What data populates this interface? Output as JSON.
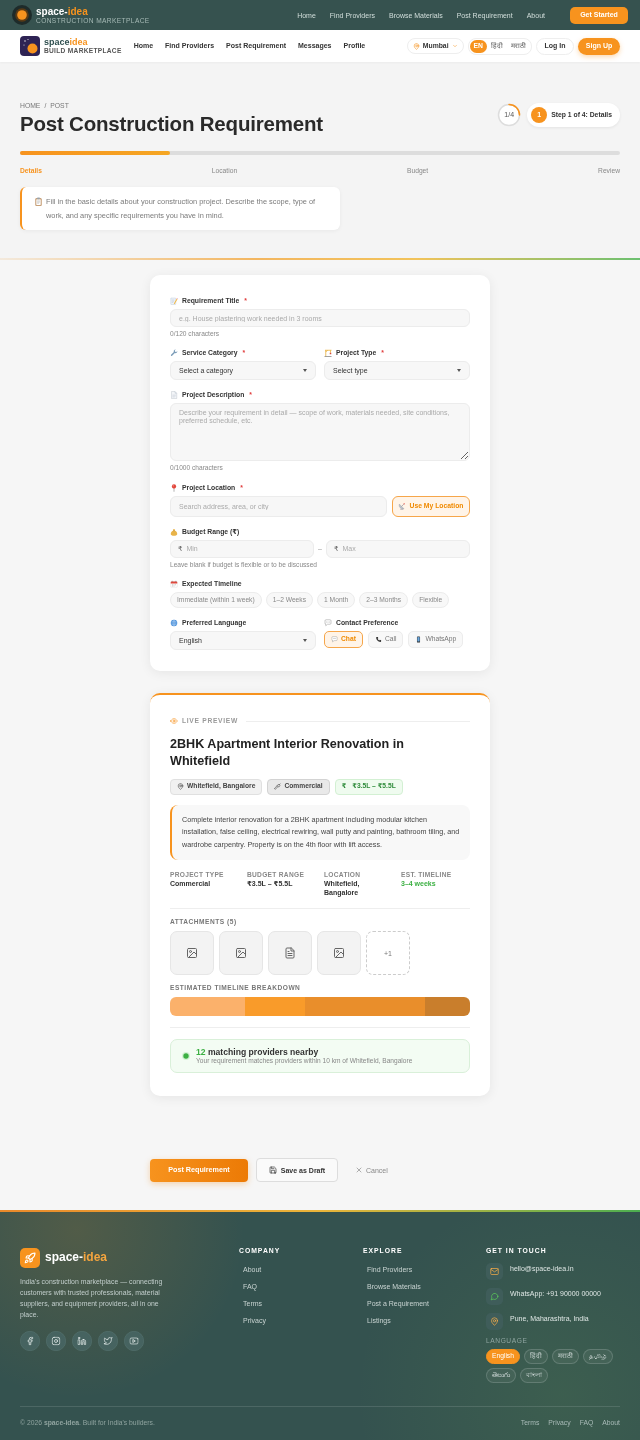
{
  "top_nav": {
    "brand": {
      "prefix": "space-",
      "accent": "idea"
    },
    "tagline": "CONSTRUCTION MARKETPLACE",
    "links": [
      "Home",
      "Find Providers",
      "Browse Materials",
      "Post Requirement",
      "About"
    ],
    "cta": "Get Started"
  },
  "main_nav": {
    "brand": {
      "prefix": "space",
      "accent": "idea"
    },
    "tagline": "BUILD MARKETPLACE",
    "links": [
      "Home",
      "Find Providers",
      "Post Requirement",
      "Messages",
      "Profile"
    ],
    "city": "Mumbai",
    "languages": [
      {
        "label": "EN",
        "selected": true
      },
      {
        "label": "हिंदी",
        "selected": false
      },
      {
        "label": "मराठी",
        "selected": false
      }
    ],
    "login": "Log In",
    "signup": "Sign Up"
  },
  "header": {
    "breadcrumb": [
      "HOME",
      "POST"
    ],
    "breadcrumb_separator": "/",
    "title": "Post Construction Requirement",
    "step_ring": {
      "label": "1/4"
    },
    "step_badge": {
      "number": "1",
      "label": "Step 1 of 4: Details"
    },
    "progress": {
      "level": 0.25
    },
    "steps": [
      {
        "label": "Details",
        "selected": true
      },
      {
        "label": "Location",
        "selected": false
      },
      {
        "label": "Budget",
        "selected": false
      },
      {
        "label": "Review",
        "selected": false
      }
    ],
    "info": "Fill in the basic details about your construction project. Describe the scope, type of work, and any specific requirements you have in mind."
  },
  "form": {
    "title_field": {
      "label": "Requirement Title",
      "required_mark": "*",
      "placeholder": "e.g. House plastering work needed in 3 rooms",
      "counter": "0/120 characters"
    },
    "category": {
      "label": "Service Category",
      "required_mark": "*",
      "value": "Select a category"
    },
    "project_type": {
      "label": "Project Type",
      "required_mark": "*",
      "value": "Select type"
    },
    "description": {
      "label": "Project Description",
      "required_mark": "*",
      "placeholder": "Describe your requirement in detail — scope of work, materials needed, site conditions, preferred schedule, etc.",
      "counter": "0/1000 characters"
    },
    "location": {
      "label": "Project Location",
      "required_mark": "*",
      "placeholder": "Search address, area, or city",
      "button": "Use My Location"
    },
    "budget": {
      "label": "Budget Range (₹)",
      "currency": "₹",
      "min_placeholder": "Min",
      "separator": "–",
      "max_placeholder": "Max",
      "hint": "Leave blank if budget is flexible or to be discussed"
    },
    "timeline": {
      "label": "Expected Timeline",
      "options": [
        {
          "label": "Immediate (within 1 week)",
          "selected": false
        },
        {
          "label": "1–2 Weeks",
          "selected": false
        },
        {
          "label": "1 Month",
          "selected": false
        },
        {
          "label": "2–3 Months",
          "selected": false
        },
        {
          "label": "Flexible",
          "selected": false
        }
      ]
    },
    "language": {
      "label": "Preferred Language",
      "value": "English"
    },
    "contact": {
      "label": "Contact Preference",
      "options": [
        {
          "kind": "chat",
          "label": "Chat",
          "selected": true
        },
        {
          "kind": "call",
          "label": "Call",
          "selected": false
        },
        {
          "kind": "whatsapp",
          "label": "WhatsApp",
          "selected": false
        }
      ]
    }
  },
  "preview": {
    "label": "LIVE PREVIEW",
    "title": "2BHK Apartment Interior Renovation in Whitefield",
    "tags": [
      {
        "kind": "location",
        "label": "Whitefield, Bangalore"
      },
      {
        "kind": "type",
        "label": "Commercial"
      },
      {
        "kind": "budget",
        "prefix": "₹",
        "label": "₹3.5L – ₹5.5L"
      }
    ],
    "description": "Complete interior renovation for a 2BHK apartment including modular kitchen installation, false ceiling, electrical rewiring, wall putty and painting, bathroom tiling, and wardrobe carpentry. Property is on the 4th floor with lift access.",
    "stats": [
      {
        "label": "PROJECT TYPE",
        "value": "Commercial",
        "highlighted": false
      },
      {
        "label": "BUDGET RANGE",
        "value": "₹3.5L – ₹5.5L",
        "highlighted": false
      },
      {
        "label": "LOCATION",
        "value": "Whitefield, Bangalore",
        "highlighted": false
      },
      {
        "label": "EST. TIMELINE",
        "value": "3–4 weeks",
        "highlighted": true
      }
    ],
    "attachments": {
      "label": "ATTACHMENTS (5)",
      "items": [
        {
          "kind": "image"
        },
        {
          "kind": "image"
        },
        {
          "kind": "document"
        },
        {
          "kind": "image"
        },
        {
          "kind": "more",
          "label": "+1"
        }
      ]
    },
    "timeline_breakdown": {
      "label": "ESTIMATED TIMELINE BREAKDOWN"
    },
    "matches": {
      "count": "12",
      "text": "matching providers nearby",
      "detail": "Your requirement matches providers within 10 km of Whitefield, Bangalore"
    }
  },
  "actions": [
    {
      "kind": "primary",
      "label": "Post Requirement"
    },
    {
      "kind": "draft",
      "label": "Save as Draft"
    },
    {
      "kind": "cancel",
      "label": "Cancel"
    }
  ],
  "footer": {
    "brand": {
      "prefix": "space-",
      "accent": "idea"
    },
    "about": "India's construction marketplace — connecting customers with trusted professionals, material suppliers, and equipment providers, all in one place.",
    "columns": [
      {
        "title": "COMPANY",
        "links": [
          "About",
          "FAQ",
          "Terms",
          "Privacy"
        ]
      },
      {
        "title": "EXPLORE",
        "links": [
          "Find Providers",
          "Browse Materials",
          "Post a Requirement",
          "Listings"
        ]
      }
    ],
    "contact": {
      "title": "GET IN TOUCH",
      "items": [
        {
          "kind": "email",
          "text": "hello@space-idea.in"
        },
        {
          "kind": "whatsapp",
          "text": "WhatsApp: +91 90000 00000"
        },
        {
          "kind": "address",
          "text": "Pune, Maharashtra, India"
        }
      ]
    },
    "language": {
      "label": "LANGUAGE",
      "options": [
        {
          "label": "English",
          "selected": true
        },
        {
          "label": "हिंदी",
          "selected": false
        },
        {
          "label": "मराठी",
          "selected": false
        },
        {
          "label": "தமிழ்",
          "selected": false
        },
        {
          "label": "తెలుగు",
          "selected": false
        },
        {
          "label": "বাংলা",
          "selected": false
        }
      ]
    },
    "copyright": "© 2026 **space-idea**. Built for India's builders.",
    "bottom_links": [
      "Terms",
      "Privacy",
      "FAQ",
      "About"
    ]
  }
}
